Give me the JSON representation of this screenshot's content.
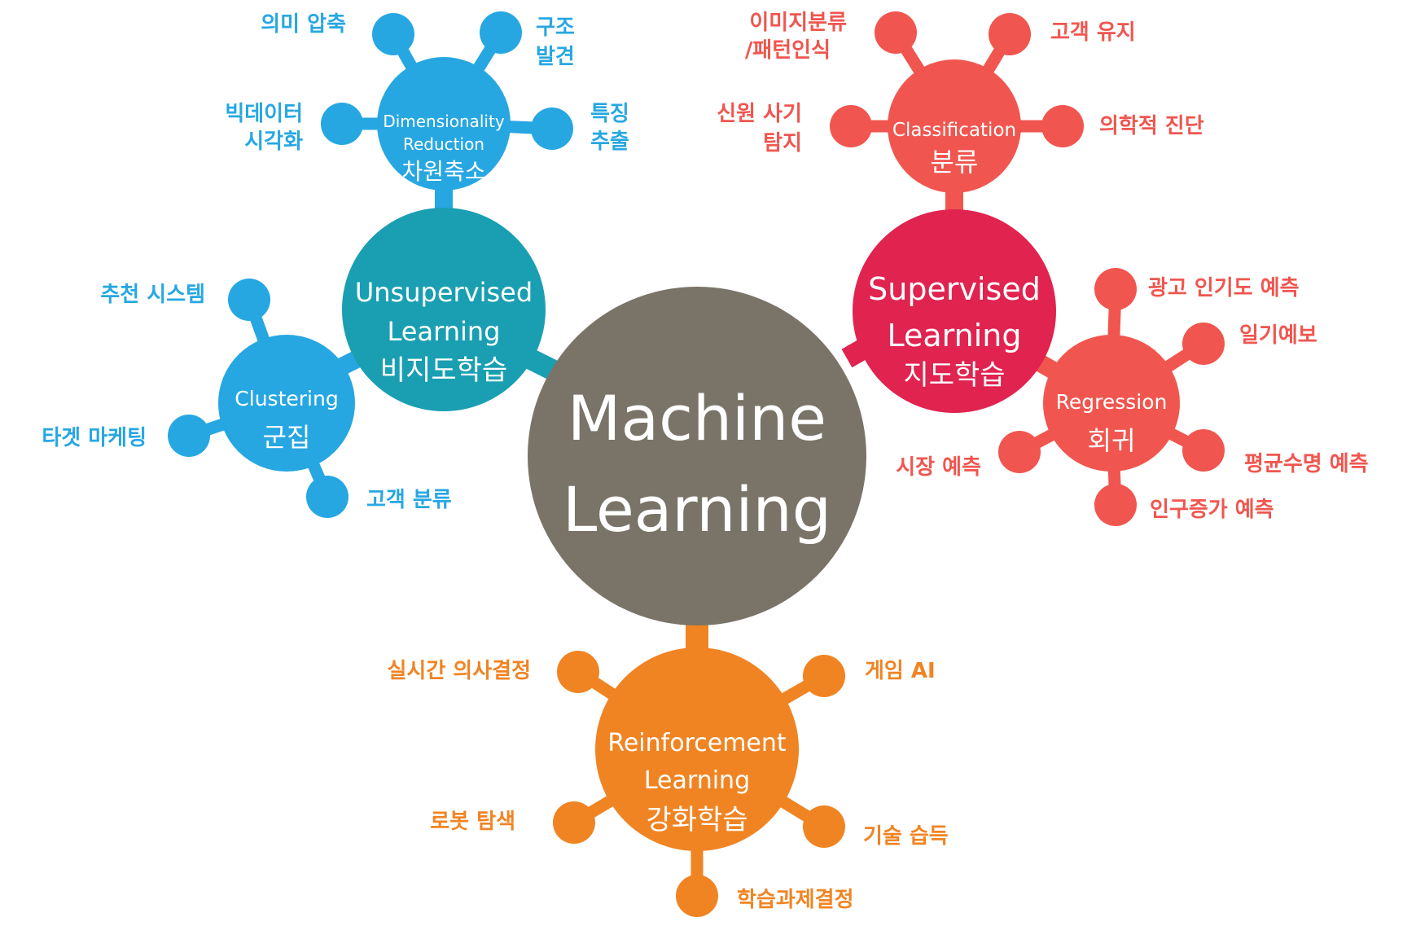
{
  "colors": {
    "center": "#7a7468",
    "unsupervised_main": "#1a9fb2",
    "unsupervised_light": "#27a7e2",
    "supervised_main": "#e0234f",
    "supervised_light": "#f0564f",
    "reinforcement": "#f08423"
  },
  "center": {
    "line1": "Machine",
    "line2": "Learning"
  },
  "unsupervised": {
    "en1": "Unsupervised",
    "en2": "Learning",
    "ko": "비지도학습",
    "dimred": {
      "en1": "Dimensionality",
      "en2": "Reduction",
      "ko": "차원축소",
      "leaves": {
        "semantic_compression": "의미 압축",
        "structure_discovery_1": "구조",
        "structure_discovery_2": "발견",
        "bigdata_vis_1": "빅데이터",
        "bigdata_vis_2": "시각화",
        "feature_extraction_1": "특징",
        "feature_extraction_2": "추출"
      }
    },
    "clustering": {
      "en": "Clustering",
      "ko": "군집",
      "leaves": {
        "recommender": "추천 시스템",
        "target_marketing": "타겟 마케팅",
        "customer_segmentation": "고객 분류"
      }
    }
  },
  "supervised": {
    "en1": "Supervised",
    "en2": "Learning",
    "ko": "지도학습",
    "classification": {
      "en": "Classification",
      "ko": "분류",
      "leaves": {
        "image_classification_1": "이미지분류",
        "image_classification_2": "/패턴인식",
        "customer_retention": "고객 유지",
        "fraud_detection_1": "신원 사기",
        "fraud_detection_2": "탐지",
        "diagnostics": "의학적 진단"
      }
    },
    "regression": {
      "en": "Regression",
      "ko": "회귀",
      "leaves": {
        "ad_popularity": "광고 인기도 예측",
        "weather": "일기예보",
        "market": "시장 예측",
        "life_expectancy": "평균수명 예측",
        "population": "인구증가 예측"
      }
    }
  },
  "reinforcement": {
    "en1": "Reinforcement",
    "en2": "Learning",
    "ko": "강화학습",
    "leaves": {
      "realtime_decisions": "실시간 의사결정",
      "game_ai": "게임 AI",
      "robot_navigation": "로봇 탐색",
      "skill_acquisition": "기술 습득",
      "learning_tasks": "학습과제결정"
    }
  }
}
